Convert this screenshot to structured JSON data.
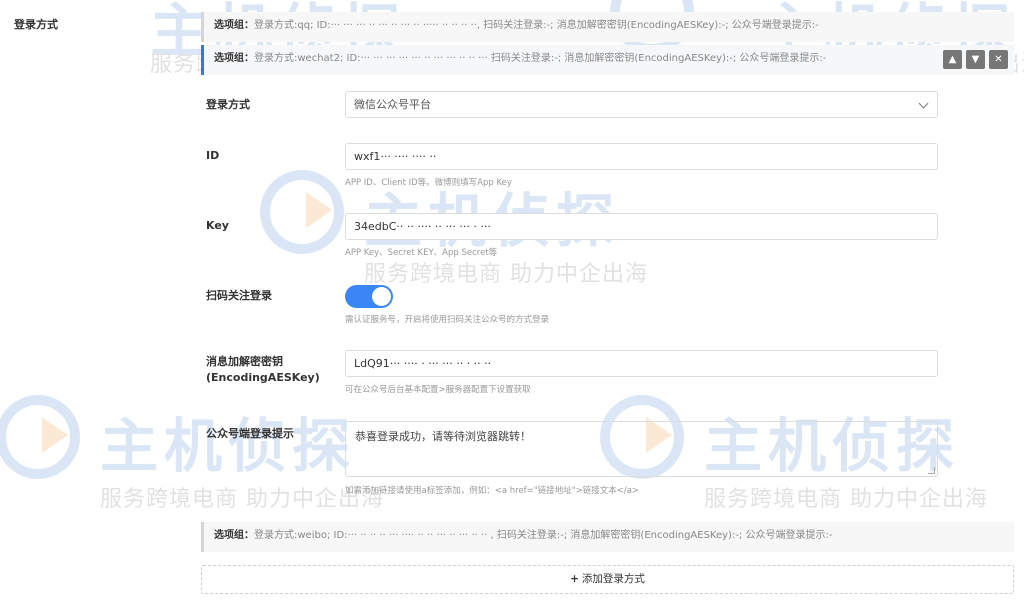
{
  "side": {
    "label": "登录方式"
  },
  "groups": [
    {
      "prefix": "选项组：",
      "text": "登录方式:qq; ID:··· ··· ··· ·· ··· ·· ··· ·· ····· ·· ·· ·· ··, 扫码关注登录:-; 消息加解密密钥(EncodingAESKey):-; 公众号端登录提示:-"
    },
    {
      "prefix": "选项组：",
      "text": "登录方式:wechat2; ID:··· ··· ··· ··· ··· ·· ··· ··· ·· ·· ··· 扫码关注登录:-; 消息加解密密钥(EncodingAESKey):-; 公众号端登录提示:-"
    },
    {
      "prefix": "选项组：",
      "text": "登录方式:weibo; ID:··· ·· ·· ·· ··· ···· ·· ·· ··· ·· ··· ·· ·· , 扫码关注登录:-; 消息加解密密钥(EncodingAESKey):-; 公众号端登录提示:-"
    }
  ],
  "tools": {
    "up": "▲",
    "down": "▼",
    "close": "✕"
  },
  "form": {
    "login_method": {
      "label": "登录方式",
      "value": "微信公众号平台"
    },
    "id": {
      "label": "ID",
      "value": "wxf1··· ···· ···· ··",
      "hint": "APP ID、Client ID等。微博则填写App Key"
    },
    "key": {
      "label": "Key",
      "value": "34edbC·· ·· ···· ·· ··· ··· · ···",
      "hint": "APP Key、Secret KEY、App Secret等"
    },
    "scan": {
      "label": "扫码关注登录",
      "on": true,
      "hint": "需认证服务号，开启将使用扫码关注公众号的方式登录"
    },
    "aes": {
      "label_line1": "消息加解密密钥",
      "label_line2": "(EncodingAESKey)",
      "value": "LdQ91··· ···· · ··· ··· ·· · ·· ··",
      "hint": "可在公众号后台基本配置>服务器配置下设置获取"
    },
    "tip": {
      "label": "公众号端登录提示",
      "value": "恭喜登录成功，请等待浏览器跳转！",
      "hint": "如需添加链接请使用a标签添加，例如：<a href=\"链接地址\">链接文本</a>"
    }
  },
  "add_button": {
    "plus": "+",
    "label": "添加登录方式"
  },
  "watermark": {
    "big": "主机侦探",
    "small": "服务跨境电商 助力中企出海"
  }
}
